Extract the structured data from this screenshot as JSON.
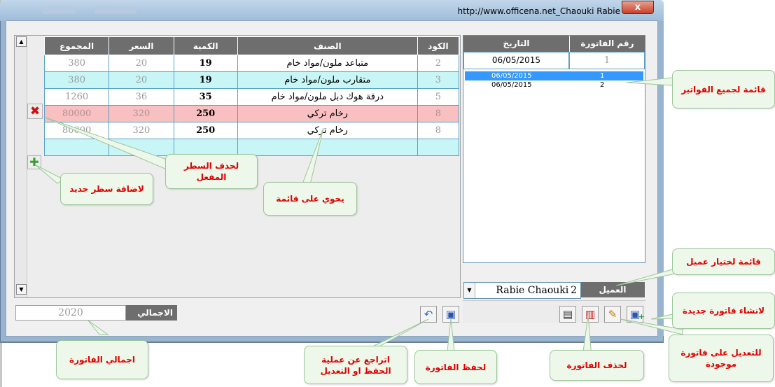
{
  "window": {
    "title": "http://www.officena.net_Chaouki Rabie",
    "close_label": "x"
  },
  "items_grid": {
    "columns": [
      "الكود",
      "الصنف",
      "الكمية",
      "السعر",
      "المجموع"
    ],
    "rows": [
      {
        "code": "2",
        "item": "متباعد ملون/مواد خام",
        "qty": "19",
        "price": "20",
        "total": "380",
        "style": "white"
      },
      {
        "code": "3",
        "item": "متقارب ملون/مواد خام",
        "qty": "19",
        "price": "20",
        "total": "380",
        "style": "cyan"
      },
      {
        "code": "5",
        "item": "درفة هوك دبل ملون/مواد خام",
        "qty": "35",
        "price": "36",
        "total": "1260",
        "style": "white"
      },
      {
        "code": "8",
        "item": "رخام تركي",
        "qty": "250",
        "price": "320",
        "total": "80000",
        "style": "pink"
      },
      {
        "code": "8",
        "item": "رخام تركي",
        "qty": "250",
        "price": "320",
        "total": "80000",
        "style": "white"
      },
      {
        "code": "",
        "item": "",
        "qty": "",
        "price": "",
        "total": "",
        "style": "cyan"
      }
    ]
  },
  "total": {
    "label": "الاجمالي",
    "value": "2020"
  },
  "invoices": {
    "header_number": "رقم الفاتورة",
    "header_date": "التاريخ",
    "current_number": "1",
    "current_date": "06/05/2015",
    "list": [
      {
        "date": "06/05/2015",
        "number": "1",
        "selected": true
      },
      {
        "date": "06/05/2015",
        "number": "2",
        "selected": false
      }
    ]
  },
  "customer": {
    "label": "العميل",
    "name": "Rabie Chaouki",
    "id": "2"
  },
  "icons": {
    "scroll_up": "▲",
    "scroll_down": "▼",
    "delete_row": "✖",
    "add_row": "✚",
    "undo": "↶",
    "save": "▣",
    "print": "▤",
    "delete_invoice": "▥",
    "edit_invoice": "✎",
    "new_invoice": "▣",
    "combo_drop": "▼",
    "new_plus": "+"
  },
  "annotations": {
    "all_invoices_list": "قائمة لجميع الفواتير",
    "customer_list": "قائمة لختيار عميل",
    "new_invoice": "لانشاء فاتورة جديدة",
    "edit_invoice": "للتعديل على فاتورة موجودة",
    "delete_invoice": "لحذف الفاتورة",
    "save_invoice": "لحفظ الفاتورة",
    "undo": "اتراجع عن عملية الحفظ او التعديل",
    "invoice_total": "اجمالي الفاتورة",
    "contains_list": "يحوي  على قائمة",
    "delete_active_row": "لحذف السطر المفعل",
    "add_new_row": "لاضافة سطر جديد"
  },
  "colors": {
    "header_bg": "#6e6e6e",
    "row_cyan": "#c8f5f5",
    "row_pink": "#f8c0c0",
    "selection": "#3399ff",
    "annotation_text": "#e00000",
    "annotation_bg": "#eef8ea"
  }
}
